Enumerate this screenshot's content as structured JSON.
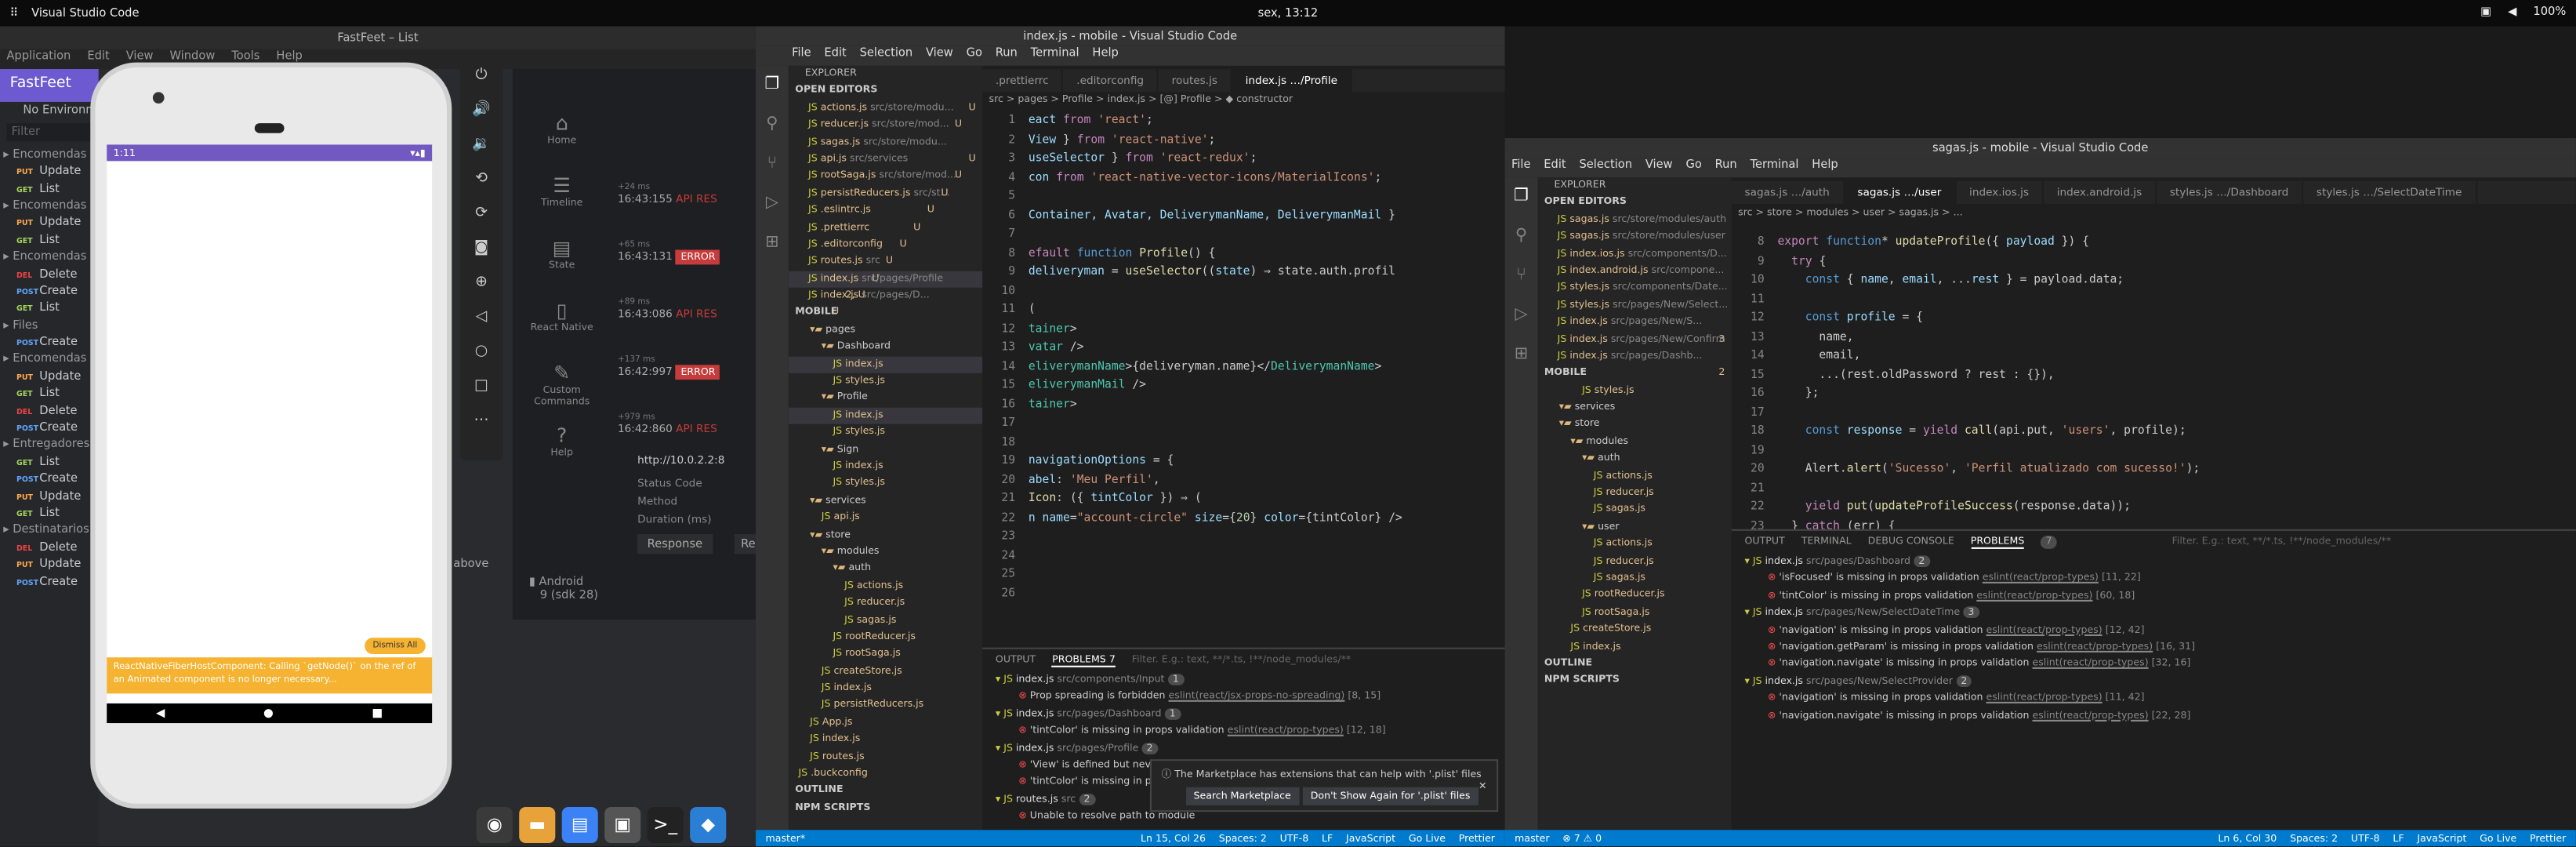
{
  "topbar": {
    "apps": "⠿",
    "app_name": "Visual Studio Code",
    "clock": "sex, 13:12",
    "battery": "100%"
  },
  "insomnia": {
    "title": "FastFeet – List",
    "menu": [
      "Application",
      "Edit",
      "View",
      "Window",
      "Tools",
      "Help"
    ],
    "sidebar_title": "FastFeet",
    "env": "No Environment",
    "filter": "Filter",
    "items": [
      {
        "m": "",
        "t": "Encomendas",
        "f": 1
      },
      {
        "m": "PUT",
        "t": "Update"
      },
      {
        "m": "GET",
        "t": "List"
      },
      {
        "m": "",
        "t": "Encomendas",
        "f": 1
      },
      {
        "m": "PUT",
        "t": "Update"
      },
      {
        "m": "GET",
        "t": "List"
      },
      {
        "m": "",
        "t": "Encomendas",
        "f": 1
      },
      {
        "m": "DEL",
        "t": "Delete"
      },
      {
        "m": "POST",
        "t": "Create"
      },
      {
        "m": "GET",
        "t": "List"
      },
      {
        "m": "",
        "t": "Files",
        "f": 1
      },
      {
        "m": "POST",
        "t": "Create"
      },
      {
        "m": "",
        "t": "Encomendas",
        "f": 1
      },
      {
        "m": "PUT",
        "t": "Update"
      },
      {
        "m": "GET",
        "t": "List"
      },
      {
        "m": "DEL",
        "t": "Delete"
      },
      {
        "m": "POST",
        "t": "Create"
      },
      {
        "m": "",
        "t": "Entregadores",
        "f": 1
      },
      {
        "m": "GET",
        "t": "List"
      },
      {
        "m": "POST",
        "t": "Create"
      },
      {
        "m": "PUT",
        "t": "Update"
      },
      {
        "m": "GET",
        "t": "List"
      },
      {
        "m": "",
        "t": "Destinatarios",
        "f": 1
      },
      {
        "m": "DEL",
        "t": "Delete"
      },
      {
        "m": "PUT",
        "t": "Update"
      },
      {
        "m": "POST",
        "t": "Create"
      }
    ],
    "sec_menu": [
      "File",
      "View",
      "Help"
    ],
    "nav": [
      {
        "ic": "⌂",
        "t": "Home"
      },
      {
        "ic": "☰",
        "t": "Timeline"
      },
      {
        "ic": "▤",
        "t": "State"
      },
      {
        "ic": "▯",
        "t": "React Native"
      },
      {
        "ic": "✎",
        "t": "Custom Commands"
      },
      {
        "ic": "?",
        "t": "Help"
      }
    ],
    "logs": [
      {
        "time": "16:43:155",
        "label": "API RES",
        "pre": "+24 ms"
      },
      {
        "time": "16:43:131",
        "label": "ERROR",
        "pre": "+65 ms",
        "err": true
      },
      {
        "time": "16:43:086",
        "label": "API RES",
        "pre": "+89 ms"
      },
      {
        "time": "16:42:997",
        "label": "ERROR",
        "pre": "+137 ms",
        "err": true
      },
      {
        "time": "16:42:860",
        "label": "API RES",
        "pre": "+979 ms"
      }
    ],
    "url": "http://10.0.2.2:8",
    "status_code": "Status Code",
    "method": "Method",
    "duration": "Duration (ms)",
    "resp": "Response",
    "re": "Re",
    "above": "above",
    "android": "Android",
    "sdk": "9 (sdk 28)"
  },
  "phone": {
    "time": "1:11",
    "dismiss": "Dismiss All",
    "warning": "ReactNativeFiberHostComponent: Calling `getNode()` on the ref of an Animated component is no longer necessary..."
  },
  "vscode1": {
    "title": "index.js - mobile - Visual Studio Code",
    "menu": [
      "File",
      "Edit",
      "Selection",
      "View",
      "Go",
      "Run",
      "Terminal",
      "Help"
    ],
    "tabs": [
      ".prettierrc",
      ".editorconfig",
      "routes.js",
      "index.js …/Profile"
    ],
    "breadcrumb": "src > pages > Profile > index.js > [@] Profile > ◆ constructor",
    "open_editors": "OPEN EDITORS",
    "open": [
      [
        "actions.js",
        "src/store/modu...",
        "U"
      ],
      [
        "reducer.js",
        "src/store/mod...",
        "U"
      ],
      [
        "sagas.js",
        "src/store/modu...",
        "U"
      ],
      [
        "api.js",
        "src/services",
        "U"
      ],
      [
        "rootSaga.js",
        "src/store/mod...",
        "U"
      ],
      [
        "persistReducers.js",
        "src/st...",
        "U"
      ],
      [
        ".eslintrc.js",
        "",
        "U"
      ],
      [
        ".prettierrc",
        "",
        "U"
      ],
      [
        ".editorconfig",
        "",
        "U"
      ],
      [
        "routes.js",
        "src",
        "U"
      ],
      [
        "index.js",
        "src/pages/Profile",
        "2, U"
      ],
      [
        "index.js",
        "src/pages/D...",
        "U"
      ]
    ],
    "mobile": "MOBILE",
    "tree": [
      [
        "pages",
        1,
        0
      ],
      [
        "Dashboard",
        2,
        0
      ],
      [
        "index.js",
        3,
        1
      ],
      [
        "styles.js",
        3,
        0
      ],
      [
        "Profile",
        2,
        0
      ],
      [
        "index.js",
        3,
        1
      ],
      [
        "styles.js",
        3,
        0
      ],
      [
        "Sign",
        2,
        0
      ],
      [
        "index.js",
        3,
        0
      ],
      [
        "styles.js",
        3,
        0
      ],
      [
        "services",
        1,
        0
      ],
      [
        "api.js",
        2,
        0
      ],
      [
        "store",
        1,
        0
      ],
      [
        "modules",
        2,
        0
      ],
      [
        "auth",
        3,
        0
      ],
      [
        "actions.js",
        4,
        0
      ],
      [
        "reducer.js",
        4,
        0
      ],
      [
        "sagas.js",
        4,
        0
      ],
      [
        "rootReducer.js",
        3,
        0
      ],
      [
        "rootSaga.js",
        3,
        0
      ],
      [
        "createStore.js",
        2,
        0
      ],
      [
        "index.js",
        2,
        0
      ],
      [
        "persistReducers.js",
        2,
        0
      ],
      [
        "App.js",
        1,
        0
      ],
      [
        "index.js",
        1,
        0
      ],
      [
        "routes.js",
        1,
        0
      ],
      [
        ".buckconfig",
        0,
        0
      ]
    ],
    "outline": "OUTLINE",
    "npm": "NPM SCRIPTS",
    "problems_title": "PROBLEMS",
    "problems_count": "7",
    "output": "OUTPUT",
    "filter": "Filter. E.g.: text, **/*.ts, !**/node_modules/**",
    "problems": [
      [
        "index.js",
        "src/components/Input",
        "1",
        1
      ],
      [
        "Prop spreading is forbidden",
        "eslint(react/jsx-props-no-spreading)",
        "[8, 15]",
        0
      ],
      [
        "index.js",
        "src/pages/Dashboard",
        "1",
        1
      ],
      [
        "'tintColor' is missing in props validation",
        "eslint(react/prop-types)",
        "[12, 18]",
        0
      ],
      [
        "index.js",
        "src/pages/Profile",
        "2",
        1
      ],
      [
        "'View' is defined but neve",
        "",
        "",
        0
      ],
      [
        "'tintColor' is missing in pr",
        "",
        "",
        0
      ],
      [
        "routes.js",
        "src",
        "2",
        1
      ],
      [
        "Unable to resolve path to module",
        "",
        "",
        0
      ]
    ],
    "toast": "The Marketplace has extensions that can help with '.plist' files",
    "toast_b1": "Search Marketplace",
    "toast_b2": "Don't Show Again for '.plist' files",
    "status": {
      "branch": "master*",
      "pos": "Ln 15, Col 26",
      "spaces": "Spaces: 2",
      "enc": "UTF-8",
      "eol": "LF",
      "lang": "JavaScript",
      "live": "Go Live",
      "prettier": "Prettier"
    },
    "code": [
      "<span class='ln'>1</span><span class='va'>eact</span> <span class='kw'>from</span> <span class='st'>'react'</span>;",
      "<span class='ln'>2</span><span class='va'>View</span> } <span class='kw'>from</span> <span class='st'>'react-native'</span>;",
      "<span class='ln'>3</span><span class='va'>useSelector</span> } <span class='kw'>from</span> <span class='st'>'react-redux'</span>;",
      "<span class='ln'>4</span><span class='va'>con</span> <span class='kw'>from</span> <span class='st'>'react-native-vector-icons/MaterialIcons'</span>;",
      "<span class='ln'>5</span>",
      "<span class='ln'>6</span><span class='va'>Container, Avatar, DeliverymanName, DeliverymanMail</span> }",
      "<span class='ln'>7</span>",
      "<span class='ln'>8</span><span class='kw'>efault</span> <span class='co'>function</span> <span class='fn'>Profile</span>() {",
      "<span class='ln'>9</span><span class='va'>deliveryman</span> = <span class='fn'>useSelector</span>((<span class='va'>state</span>) ⇒ state.auth.profil",
      "<span class='ln'>10</span>",
      "<span class='ln'>11</span>(",
      "<span class='ln'>12</span><span class='ty'>tainer</span>>",
      "<span class='ln'>13</span><span class='ty'>vatar</span> />",
      "<span class='ln'>14</span><span class='ty'>eliverymanName</span>>{deliveryman.name}&lt;/<span class='ty'>DeliverymanName</span>>",
      "<span class='ln'>15</span><span class='ty'>eliverymanMail</span> />",
      "<span class='ln'>16</span><span class='ty'>tainer</span>>",
      "<span class='ln'>17</span>",
      "<span class='ln'>18</span>",
      "<span class='ln'>19</span><span class='va'>navigationOptions</span> = {",
      "<span class='ln'>20</span><span class='va'>abel</span>: <span class='st'>'Meu Perfil'</span>,",
      "<span class='ln'>21</span><span class='fn'>Icon</span>: ({ <span class='va'>tintColor</span> }) ⇒ (",
      "<span class='ln'>22</span><span class='va'>n name</span>=<span class='st'>\"account-circle\"</span> <span class='va'>size</span>={<span class='nu'>20</span>} <span class='va'>color</span>={tintColor} />",
      "<span class='ln'>23</span>",
      "<span class='ln'>24</span>",
      "<span class='ln'>25</span>",
      "<span class='ln'>26</span>"
    ]
  },
  "vscode2": {
    "title": "sagas.js - mobile - Visual Studio Code",
    "menu": [
      "File",
      "Edit",
      "Selection",
      "View",
      "Go",
      "Run",
      "Terminal",
      "Help"
    ],
    "tabs": [
      "sagas.js …/auth",
      "sagas.js …/user",
      "index.ios.js",
      "index.android.js",
      "styles.js …/Dashboard",
      "styles.js …/SelectDateTime"
    ],
    "breadcrumb": "src > store > modules > user > sagas.js > ...",
    "open_editors": "OPEN EDITORS",
    "open": [
      [
        "sagas.js",
        "src/store/modules/auth",
        ""
      ],
      [
        "sagas.js",
        "src/store/modules/user",
        ""
      ],
      [
        "index.ios.js",
        "src/components/D...",
        ""
      ],
      [
        "index.android.js",
        "src/compone...",
        ""
      ],
      [
        "styles.js",
        "src/components/Date...",
        ""
      ],
      [
        "styles.js",
        "src/pages/New/Select...",
        ""
      ],
      [
        "index.js",
        "src/pages/New/S...",
        "3"
      ],
      [
        "index.js",
        "src/pages/New/Confirm",
        ""
      ],
      [
        "index.js",
        "src/pages/Dashb...",
        "2"
      ]
    ],
    "mobile": "MOBILE",
    "tree": [
      [
        "styles.js",
        3
      ],
      [
        "services",
        1
      ],
      [
        "store",
        1
      ],
      [
        "modules",
        2
      ],
      [
        "auth",
        3
      ],
      [
        "actions.js",
        4
      ],
      [
        "reducer.js",
        4
      ],
      [
        "sagas.js",
        4
      ],
      [
        "user",
        3
      ],
      [
        "actions.js",
        4
      ],
      [
        "reducer.js",
        4
      ],
      [
        "sagas.js",
        4
      ],
      [
        "rootReducer.js",
        3
      ],
      [
        "rootSaga.js",
        3
      ],
      [
        "createStore.js",
        2
      ],
      [
        "index.js",
        2
      ]
    ],
    "outline": "OUTLINE",
    "npm": "NPM SCRIPTS",
    "ptabs": [
      "OUTPUT",
      "TERMINAL",
      "DEBUG CONSOLE",
      "PROBLEMS"
    ],
    "pcount": "7",
    "filter": "Filter. E.g.: text, **/*.ts, !**/node_modules/**",
    "problems": [
      [
        "index.js",
        "src/pages/Dashboard",
        "2",
        1
      ],
      [
        "'isFocused' is missing in props validation",
        "eslint(react/prop-types)",
        "[11, 22]",
        0
      ],
      [
        "'tintColor' is missing in props validation",
        "eslint(react/prop-types)",
        "[60, 18]",
        0
      ],
      [
        "index.js",
        "src/pages/New/SelectDateTime",
        "3",
        1
      ],
      [
        "'navigation' is missing in props validation",
        "eslint(react/prop-types)",
        "[12, 42]",
        0
      ],
      [
        "'navigation.getParam' is missing in props validation",
        "eslint(react/prop-types)",
        "[16, 31]",
        0
      ],
      [
        "'navigation.navigate' is missing in props validation",
        "eslint(react/prop-types)",
        "[32, 16]",
        0
      ],
      [
        "index.js",
        "src/pages/New/SelectProvider",
        "2",
        1
      ],
      [
        "'navigation' is missing in props validation",
        "eslint(react/prop-types)",
        "[11, 42]",
        0
      ],
      [
        "'navigation.navigate' is missing in props validation",
        "eslint(react/prop-types)",
        "[22, 28]",
        0
      ]
    ],
    "status": {
      "branch": "master",
      "problems": "⊗ 7 ⚠ 0",
      "pos": "Ln 6, Col 30",
      "spaces": "Spaces: 2",
      "enc": "UTF-8",
      "eol": "LF",
      "lang": "JavaScript",
      "live": "Go Live",
      "prettier": "Prettier"
    },
    "code": [
      "<span class='ln'>8</span><span class='kw'>export</span> <span class='co'>function</span>* <span class='fn'>updateProfile</span>({ <span class='va'>payload</span> }) {",
      "<span class='ln'>9</span>  <span class='kw'>try</span> {",
      "<span class='ln'>10</span>    <span class='co'>const</span> { <span class='va'>name</span>, <span class='va'>email</span>, ...<span class='va'>rest</span> } = payload.data;",
      "<span class='ln'>11</span>",
      "<span class='ln'>12</span>    <span class='co'>const</span> <span class='va'>profile</span> = {",
      "<span class='ln'>13</span>      name,",
      "<span class='ln'>14</span>      email,",
      "<span class='ln'>15</span>      ...(rest.oldPassword ? rest : {}),",
      "<span class='ln'>16</span>    };",
      "<span class='ln'>17</span>",
      "<span class='ln'>18</span>    <span class='co'>const</span> <span class='va'>response</span> = <span class='kw'>yield</span> <span class='fn'>call</span>(api.put, <span class='st'>'users'</span>, profile);",
      "<span class='ln'>19</span>",
      "<span class='ln'>20</span>    Alert.<span class='fn'>alert</span>(<span class='st'>'Sucesso'</span>, <span class='st'>'Perfil atualizado com sucesso!'</span>);",
      "<span class='ln'>21</span>",
      "<span class='ln'>22</span>    <span class='kw'>yield</span> <span class='fn'>put</span>(<span class='fn'>updateProfileSuccess</span>(response.data));",
      "<span class='ln'>23</span>  } <span class='kw'>catch</span> (err) {"
    ]
  },
  "dock": [
    {
      "i": "◉",
      "c": "#3a3a3a"
    },
    {
      "i": "▬",
      "c": "#e8a23a"
    },
    {
      "i": "▤",
      "c": "#3b82f6"
    },
    {
      "i": "▣",
      "c": "#555"
    },
    {
      "i": ">_",
      "c": "#222"
    },
    {
      "i": "◆",
      "c": "#2a7fd4"
    }
  ],
  "colors": {
    "accent": "#7159c1",
    "vscode_blue": "#007acc",
    "error": "#c63b3b"
  }
}
